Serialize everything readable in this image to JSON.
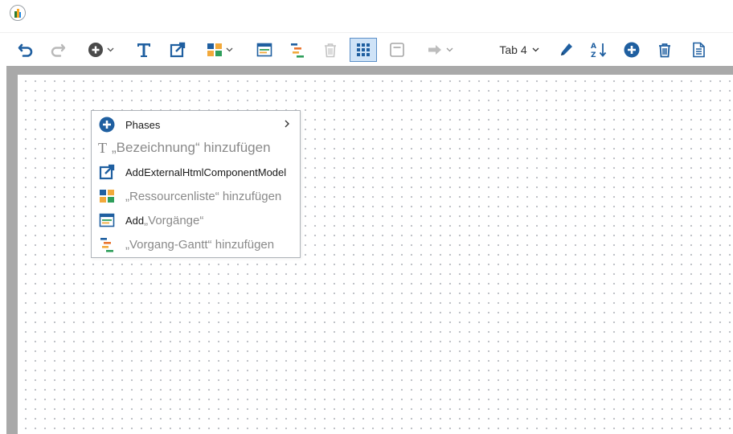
{
  "app": {
    "logo_icon": "app-logo-icon"
  },
  "toolbar": {
    "undo_icon": "undo-icon",
    "redo_icon": "redo-icon",
    "add_icon": "add-circle-icon",
    "text_icon": "text-icon",
    "external_icon": "external-link-icon",
    "resources_icon": "resource-list-icon",
    "activities_icon": "activities-icon",
    "gantt_icon": "gantt-icon",
    "delete_icon": "trash-icon",
    "grid_icon": "grid-icon",
    "frame_icon": "frame-icon",
    "arrow_icon": "arrow-right-icon",
    "tab_label": "Tab 4",
    "edit_icon": "pencil-icon",
    "sort_icon": "sort-az-icon",
    "add_tab_icon": "add-circle-icon",
    "delete_tab_icon": "trash-icon",
    "page_icon": "document-icon"
  },
  "context_menu": {
    "items": [
      {
        "label": "Phases",
        "icon": "add-circle-icon",
        "has_submenu": true
      },
      {
        "glyph": "T",
        "label": "„Bezeichnung“ hinzufügen",
        "icon": "text-icon"
      },
      {
        "label": "AddExternalHtmlComponentModel",
        "icon": "external-link-icon"
      },
      {
        "label": "„Ressourcenliste“ hinzufügen",
        "icon": "resource-list-icon"
      },
      {
        "label_bold": "Add",
        "label_rest": "„Vorgänge“",
        "icon": "activities-icon"
      },
      {
        "label": "„Vorgang-Gantt“ hinzufügen",
        "icon": "gantt-icon"
      }
    ]
  },
  "colors": {
    "primary_blue": "#1f5fa0",
    "canvas_border": "#a9a9a9",
    "active_button_bg": "#cfe3f7"
  }
}
